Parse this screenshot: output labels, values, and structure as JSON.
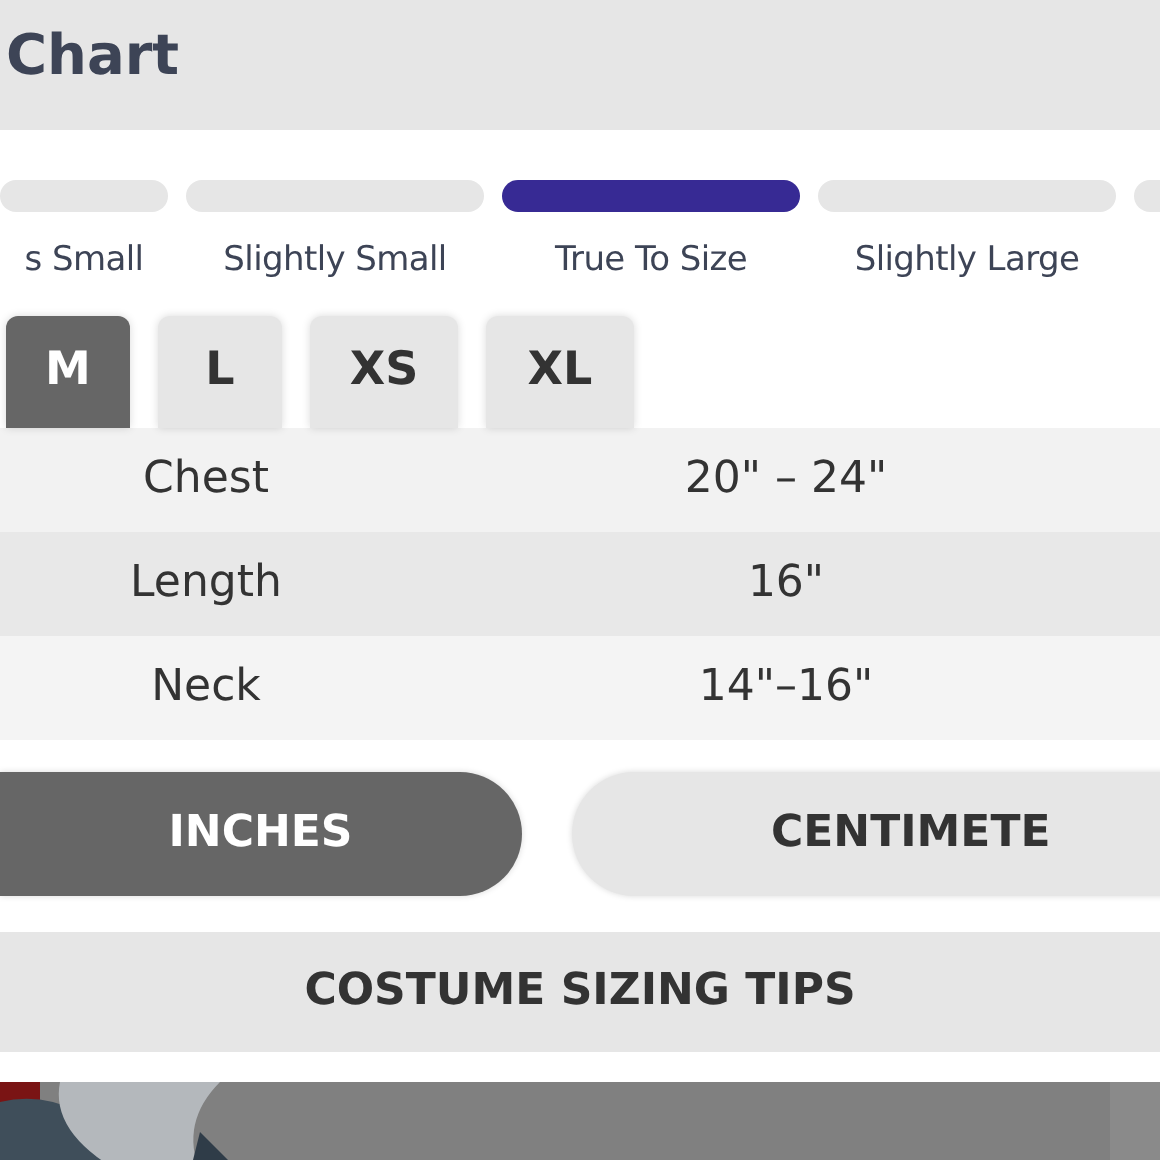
{
  "header": {
    "title": "Chart"
  },
  "fit_scale": [
    {
      "label": "s Small",
      "selected": false
    },
    {
      "label": "Slightly Small",
      "selected": false
    },
    {
      "label": "True To Size",
      "selected": true
    },
    {
      "label": "Slightly Large",
      "selected": false
    },
    {
      "selected": false
    }
  ],
  "sizes": [
    {
      "label": "M",
      "selected": true
    },
    {
      "label": "L",
      "selected": false
    },
    {
      "label": "XS",
      "selected": false
    },
    {
      "label": "XL",
      "selected": false
    }
  ],
  "measurements": [
    {
      "name": "Chest",
      "value": "20\" – 24\""
    },
    {
      "name": "Length",
      "value": "16\""
    },
    {
      "name": "Neck",
      "value": "14\"–16\""
    }
  ],
  "units": [
    {
      "label": "INCHES",
      "selected": true
    },
    {
      "label": "CENTIMETE",
      "selected": false
    }
  ],
  "tips_button": "COSTUME SIZING TIPS"
}
